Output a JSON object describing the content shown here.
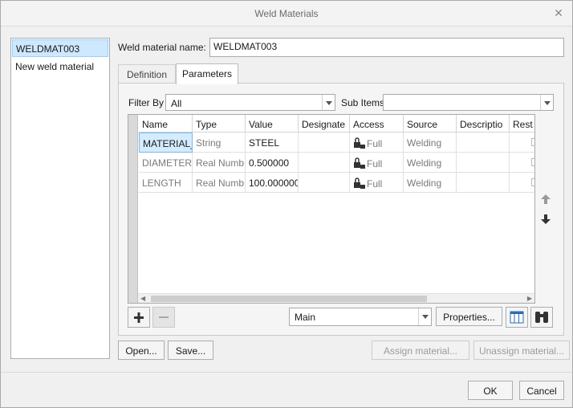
{
  "window": {
    "title": "Weld Materials"
  },
  "materials_list": [
    {
      "label": "WELDMAT003",
      "selected": true
    },
    {
      "label": "New weld material",
      "selected": false
    }
  ],
  "name_field": {
    "label": "Weld material name:",
    "value": "WELDMAT003"
  },
  "tabs": [
    {
      "label": "Definition",
      "active": false
    },
    {
      "label": "Parameters",
      "active": true
    }
  ],
  "filter": {
    "label": "Filter By",
    "value": "All",
    "sub_items_label": "Sub Items",
    "sub_items_value": ""
  },
  "table": {
    "columns": [
      "Name",
      "Type",
      "Value",
      "Designate",
      "Access",
      "Source",
      "Descriptio",
      "Rest"
    ],
    "rows": [
      {
        "name": "MATERIAL_",
        "type": "String",
        "value": "STEEL",
        "designate": "",
        "access": "Full",
        "source": "Welding",
        "description": "",
        "selected": true
      },
      {
        "name": "DIAMETER",
        "type": "Real Numb",
        "value": "0.500000",
        "designate": "",
        "access": "Full",
        "source": "Welding",
        "description": "",
        "selected": false
      },
      {
        "name": "LENGTH",
        "type": "Real Numb",
        "value": "100.000000",
        "designate": "",
        "access": "Full",
        "source": "Welding",
        "description": "",
        "selected": false
      }
    ]
  },
  "bottom_bar": {
    "view_value": "Main",
    "properties_label": "Properties..."
  },
  "buttons": {
    "open": "Open...",
    "save": "Save...",
    "assign": "Assign material...",
    "unassign": "Unassign material...",
    "ok": "OK",
    "cancel": "Cancel"
  },
  "icons": {
    "close": "close-icon",
    "add": "plus-icon",
    "remove": "minus-icon",
    "up": "arrow-up-icon",
    "down": "arrow-down-icon",
    "columns": "table-columns-icon",
    "find": "binoculars-icon",
    "lock": "lock-icon"
  },
  "colors": {
    "selection": "#cde8ff",
    "selection_border": "#99d1ff",
    "cell_selection": "#d4ecff"
  }
}
